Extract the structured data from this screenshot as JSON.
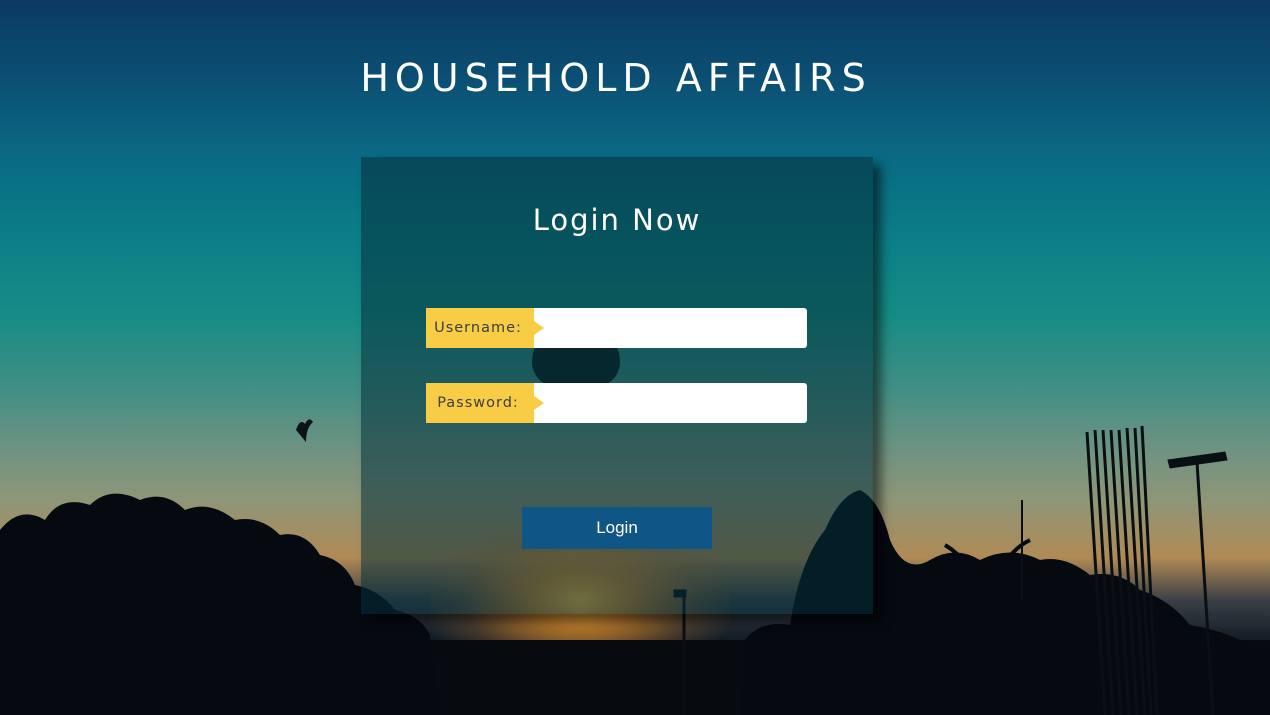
{
  "header": {
    "title": "HOUSEHOLD AFFAIRS"
  },
  "login_form": {
    "heading": "Login Now",
    "username": {
      "label": "Username:",
      "value": "",
      "placeholder": ""
    },
    "password": {
      "label": "Password:",
      "value": "",
      "placeholder": ""
    },
    "submit_label": "Login"
  },
  "colors": {
    "label_background": "#f9cc46",
    "button_background": "#0f5585",
    "card_background": "rgba(4,48,58,0.55)",
    "text": "#ffffff"
  },
  "icons": {
    "label_pointer": "triangle-right-icon"
  }
}
